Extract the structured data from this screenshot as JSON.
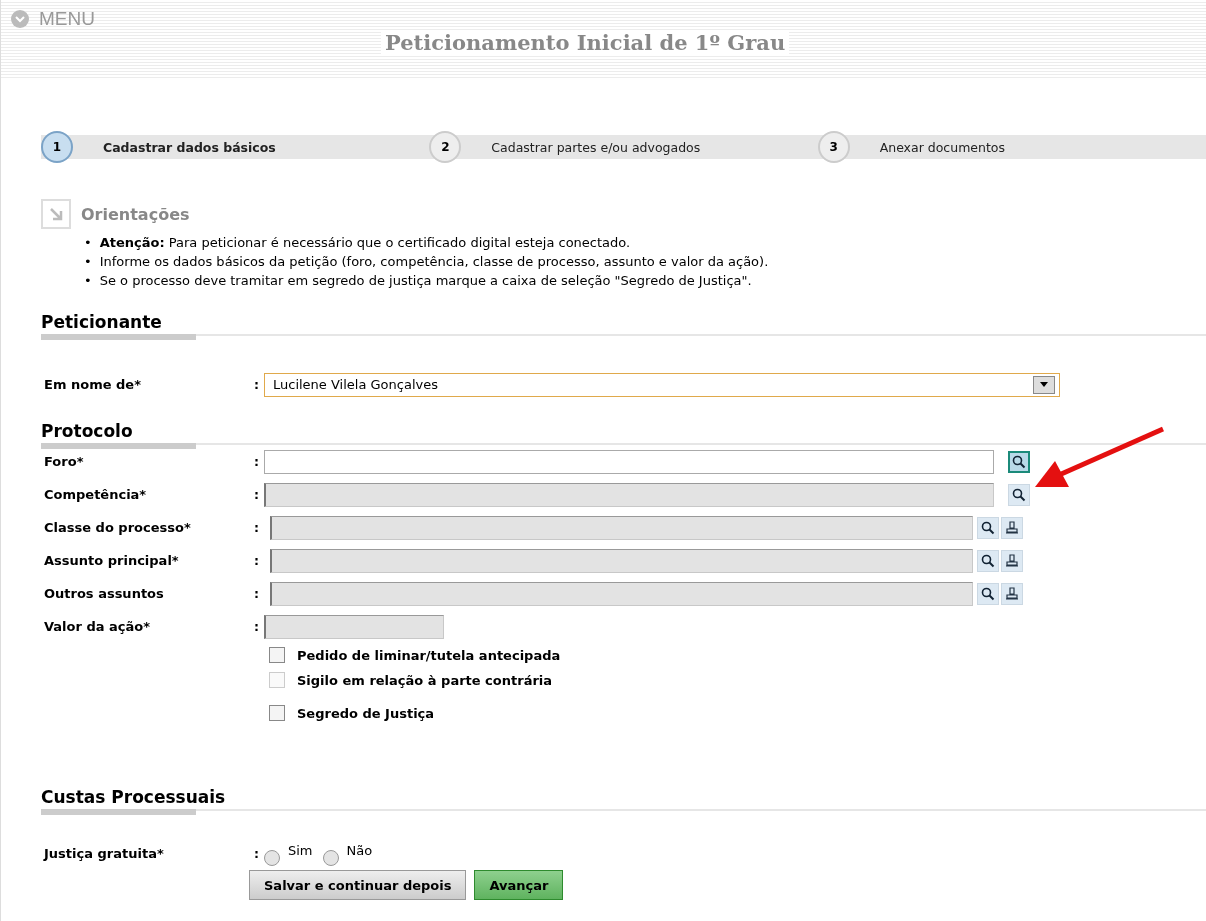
{
  "menu": {
    "label": "MENU"
  },
  "title": "Peticionamento Inicial de 1º Grau",
  "steps": [
    {
      "number": "1",
      "label": "Cadastrar dados básicos",
      "selected": true
    },
    {
      "number": "2",
      "label": "Cadastrar partes e/ou advogados",
      "selected": false
    },
    {
      "number": "3",
      "label": "Anexar documentos",
      "selected": false
    }
  ],
  "guidance": {
    "title": "Orientações",
    "items": [
      {
        "marker": "•",
        "text": "**Atenção:** Para peticionar é necessário que o certificado digital esteja conectado."
      },
      {
        "marker": "•",
        "text": "Informe os dados básicos da petição (foro, competência, classe de processo, assunto e valor da ação)."
      },
      {
        "marker": "•",
        "text": "Se o processo deve tramitar em segredo de justiça marque a caixa de seleção \"Segredo de Justiça\"."
      }
    ]
  },
  "sections": [
    {
      "title": "Peticionante",
      "fields": [
        {
          "kind": "select",
          "label": "Em nome de*",
          "separator": ":",
          "value": "Lucilene Vilela Gonçalves"
        }
      ]
    },
    {
      "title": "Protocolo",
      "fields": [
        {
          "kind": "text",
          "label": "Foro*",
          "separator": ":",
          "disabled": false,
          "tools": [
            {
              "kind": "search",
              "highlighted": true
            }
          ]
        },
        {
          "kind": "text",
          "label": "Competência*",
          "separator": ":",
          "disabled": true,
          "tools": [
            {
              "kind": "search",
              "highlighted": false
            }
          ]
        },
        {
          "kind": "text",
          "label": "Classe do processo*",
          "separator": ":",
          "disabled": true,
          "tools": [
            {
              "kind": "search",
              "highlighted": false
            },
            {
              "kind": "stamp",
              "highlighted": false
            }
          ]
        },
        {
          "kind": "text",
          "label": "Assunto principal*",
          "separator": ":",
          "disabled": true,
          "tools": [
            {
              "kind": "search",
              "highlighted": false
            },
            {
              "kind": "stamp",
              "highlighted": false
            }
          ]
        },
        {
          "kind": "text",
          "label": "Outros assuntos",
          "separator": ":",
          "disabled": true,
          "tools": [
            {
              "kind": "search",
              "highlighted": false
            },
            {
              "kind": "stamp",
              "highlighted": false
            }
          ]
        },
        {
          "kind": "short",
          "label": "Valor da ação*",
          "separator": ":",
          "disabled": true
        }
      ],
      "checkboxes": [
        {
          "label": "Pedido de liminar/tutela antecipada",
          "checked": false,
          "disabled": false
        },
        {
          "label": "Sigilo em relação à parte contrária",
          "checked": false,
          "disabled": true
        },
        {
          "label": "Segredo de Justiça",
          "checked": false,
          "disabled": false
        }
      ]
    },
    {
      "title": "Custas Processuais",
      "radio_group": {
        "label": "Justiça gratuita*",
        "separator": ":",
        "options": [
          {
            "label": "Sim",
            "selected": false
          },
          {
            "label": "Não",
            "selected": false
          }
        ]
      }
    }
  ],
  "buttons": [
    {
      "label": "Salvar e continuar depois",
      "kind": "secondary"
    },
    {
      "label": "Avançar",
      "kind": "primary"
    }
  ]
}
